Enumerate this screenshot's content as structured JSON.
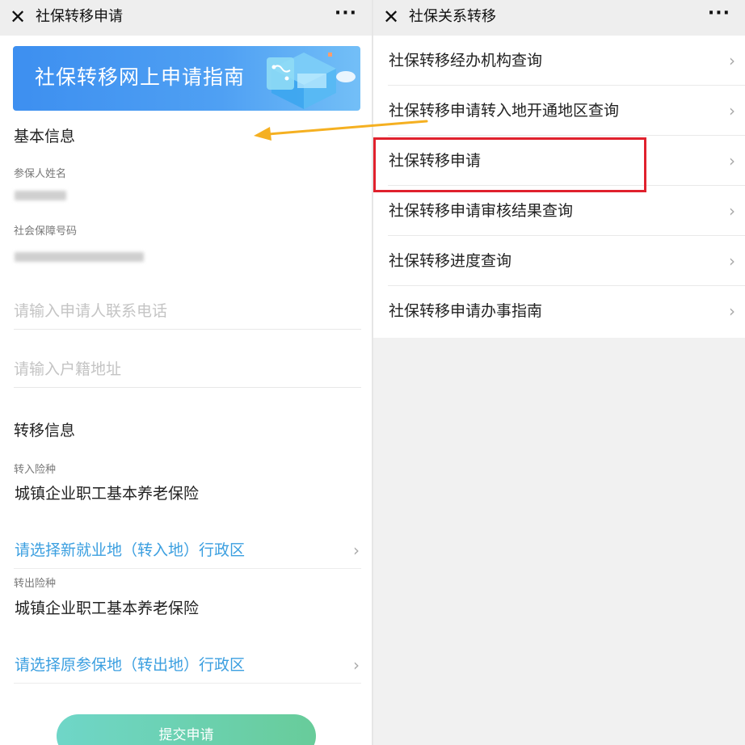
{
  "left": {
    "title": "社保转移申请",
    "banner_text": "社保转移网上申请指南",
    "basic_section": "基本信息",
    "insured_name_label": "参保人姓名",
    "social_security_label": "社会保障号码",
    "phone_placeholder": "请输入申请人联系电话",
    "address_placeholder": "请输入户籍地址",
    "transfer_section": "转移信息",
    "in_type_label": "转入险种",
    "in_type_value": "城镇企业职工基本养老保险",
    "select_in_region": "请选择新就业地（转入地）行政区",
    "out_type_label": "转出险种",
    "out_type_value": "城镇企业职工基本养老保险",
    "select_out_region": "请选择原参保地（转出地）行政区",
    "submit_label": "提交申请"
  },
  "right": {
    "title": "社保关系转移",
    "items": [
      {
        "label": "社保转移经办机构查询"
      },
      {
        "label": "社保转移申请转入地开通地区查询"
      },
      {
        "label": "社保转移申请"
      },
      {
        "label": "社保转移申请审核结果查询"
      },
      {
        "label": "社保转移进度查询"
      },
      {
        "label": "社保转移申请办事指南"
      }
    ],
    "highlight_color": "#e0212d"
  },
  "icons": {
    "close": "close-icon",
    "more": "more-icon",
    "chevron": "chevron-right-icon"
  },
  "colors": {
    "banner": "#3d8ff0",
    "select_text": "#3b9fe0",
    "submit": "#6fd6c8",
    "arrow": "#f5b021"
  }
}
